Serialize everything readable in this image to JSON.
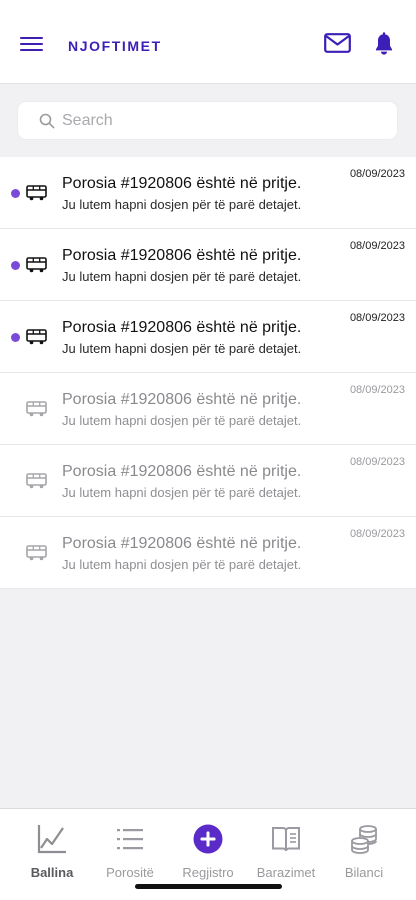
{
  "header": {
    "title": "NJOFTIMET",
    "menu_icon": "hamburger-menu-icon",
    "mail_icon": "mail-icon",
    "bell_icon": "bell-icon"
  },
  "search": {
    "placeholder": "Search",
    "value": ""
  },
  "notifications": [
    {
      "title": "Porosia #1920806 është në pritje.",
      "subtitle": "Ju lutem hapni dosjen për të parë detajet.",
      "date": "08/09/2023",
      "unread": true,
      "icon": "bus-icon"
    },
    {
      "title": "Porosia #1920806 është në pritje.",
      "subtitle": "Ju lutem hapni dosjen për të parë detajet.",
      "date": "08/09/2023",
      "unread": true,
      "icon": "bus-icon"
    },
    {
      "title": "Porosia #1920806 është në pritje.",
      "subtitle": "Ju lutem hapni dosjen për të parë detajet.",
      "date": "08/09/2023",
      "unread": true,
      "icon": "bus-icon"
    },
    {
      "title": "Porosia #1920806 është në pritje.",
      "subtitle": "Ju lutem hapni dosjen për të parë detajet.",
      "date": "08/09/2023",
      "unread": false,
      "icon": "bus-icon"
    },
    {
      "title": "Porosia #1920806 është në pritje.",
      "subtitle": "Ju lutem hapni dosjen për të parë detajet.",
      "date": "08/09/2023",
      "unread": false,
      "icon": "bus-icon"
    },
    {
      "title": "Porosia #1920806 është në pritje.",
      "subtitle": "Ju lutem hapni dosjen për të parë detajet.",
      "date": "08/09/2023",
      "unread": false,
      "icon": "bus-icon"
    }
  ],
  "bottom_nav": {
    "items": [
      {
        "label": "Ballina",
        "icon": "line-chart-icon",
        "active": true
      },
      {
        "label": "Porositë",
        "icon": "list-icon",
        "active": false
      },
      {
        "label": "Regjistro",
        "icon": "add-circle-icon",
        "active": false
      },
      {
        "label": "Barazimet",
        "icon": "open-book-icon",
        "active": false
      },
      {
        "label": "Bilanci",
        "icon": "coins-stack-icon",
        "active": false
      }
    ]
  },
  "colors": {
    "accent": "#3d1fb8",
    "unread_dot": "#7a4ad8",
    "add_button": "#5b2bc9"
  }
}
